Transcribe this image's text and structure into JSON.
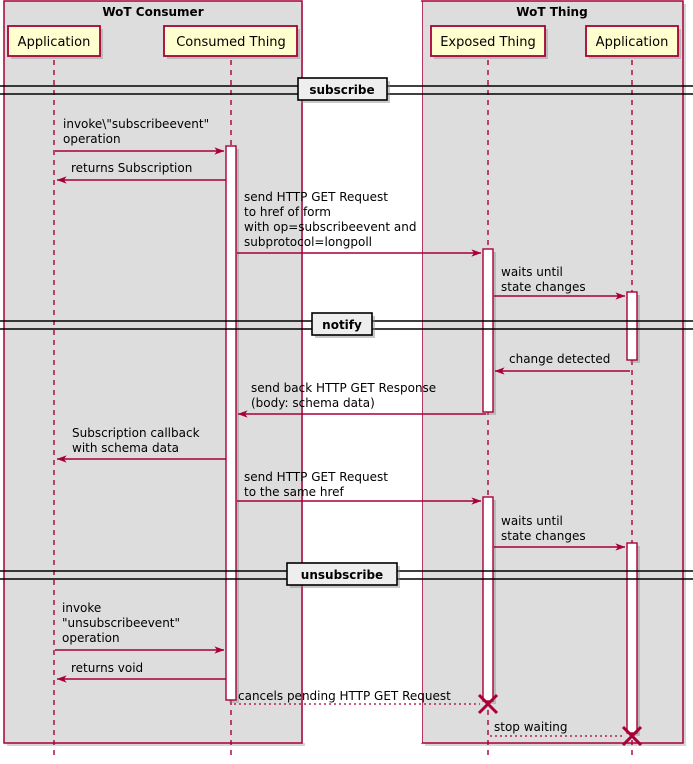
{
  "diagram": {
    "type": "uml-sequence-diagram",
    "colors": {
      "accent": "#A80036",
      "group_background": "#DDDDDD",
      "page_background": "#FFFFFF",
      "participant_fill": "#FEFECE",
      "participant_border": "#A80036",
      "divider_fill": "#EEEEEE",
      "divider_border": "#000000",
      "text": "#000000",
      "shadow": "#888888"
    }
  },
  "groups": [
    {
      "id": "wot-consumer",
      "title": "WoT Consumer"
    },
    {
      "id": "wot-thing",
      "title": "WoT Thing"
    }
  ],
  "participants": [
    {
      "id": "consumer-application",
      "label": "Application",
      "group": "wot-consumer"
    },
    {
      "id": "consumed-thing",
      "label": "Consumed Thing",
      "group": "wot-consumer"
    },
    {
      "id": "exposed-thing",
      "label": "Exposed Thing",
      "group": "wot-thing"
    },
    {
      "id": "thing-application",
      "label": "Application",
      "group": "wot-thing"
    }
  ],
  "dividers": [
    {
      "id": "divider-subscribe",
      "label": "subscribe"
    },
    {
      "id": "divider-notify",
      "label": "notify"
    },
    {
      "id": "divider-unsubscribe",
      "label": "unsubscribe"
    }
  ],
  "messages": [
    {
      "id": "msg-invoke-subscribeevent",
      "from": "consumer-application",
      "to": "consumed-thing",
      "style": "solid",
      "direction": "right",
      "lines": [
        "invoke\\\"subscribeevent\"",
        "operation"
      ]
    },
    {
      "id": "msg-returns-subscription",
      "from": "consumed-thing",
      "to": "consumer-application",
      "style": "solid",
      "direction": "left",
      "lines": [
        "returns Subscription"
      ]
    },
    {
      "id": "msg-send-http-get-request-subscribe",
      "from": "consumed-thing",
      "to": "exposed-thing",
      "style": "solid",
      "direction": "right",
      "lines": [
        "send HTTP GET Request",
        "to href of form",
        " with op=subscribeevent and",
        " subprotocol=longpoll"
      ]
    },
    {
      "id": "msg-waits-until-state-changes-1",
      "from": "exposed-thing",
      "to": "thing-application",
      "style": "solid",
      "direction": "right",
      "lines": [
        "waits until",
        " state changes"
      ]
    },
    {
      "id": "msg-change-detected",
      "from": "thing-application",
      "to": "exposed-thing",
      "style": "solid",
      "direction": "left",
      "lines": [
        "change detected"
      ]
    },
    {
      "id": "msg-send-back-http-get-response",
      "from": "exposed-thing",
      "to": "consumed-thing",
      "style": "solid",
      "direction": "left",
      "lines": [
        "send back HTTP GET Response",
        " (body: schema data)"
      ]
    },
    {
      "id": "msg-subscription-callback",
      "from": "consumed-thing",
      "to": "consumer-application",
      "style": "solid",
      "direction": "left",
      "lines": [
        "Subscription callback",
        " with schema data"
      ]
    },
    {
      "id": "msg-send-http-get-request-same-href",
      "from": "consumed-thing",
      "to": "exposed-thing",
      "style": "solid",
      "direction": "right",
      "lines": [
        "send HTTP GET Request",
        " to the same href"
      ]
    },
    {
      "id": "msg-waits-until-state-changes-2",
      "from": "exposed-thing",
      "to": "thing-application",
      "style": "solid",
      "direction": "right",
      "lines": [
        "waits until",
        " state changes"
      ]
    },
    {
      "id": "msg-invoke-unsubscribeevent",
      "from": "consumer-application",
      "to": "consumed-thing",
      "style": "solid",
      "direction": "right",
      "lines": [
        "invoke",
        "\"unsubscribeevent\"",
        "operation"
      ]
    },
    {
      "id": "msg-returns-void",
      "from": "consumed-thing",
      "to": "consumer-application",
      "style": "solid",
      "direction": "left",
      "lines": [
        "returns void"
      ]
    },
    {
      "id": "msg-cancels-pending-request",
      "from": "consumed-thing",
      "to": "exposed-thing",
      "style": "dotted",
      "direction": "right",
      "terminator": "cross",
      "lines": [
        "cancels pending HTTP GET Request"
      ]
    },
    {
      "id": "msg-stop-waiting",
      "from": "exposed-thing",
      "to": "thing-application",
      "style": "dotted",
      "direction": "right",
      "terminator": "cross",
      "lines": [
        "stop waiting"
      ]
    }
  ]
}
